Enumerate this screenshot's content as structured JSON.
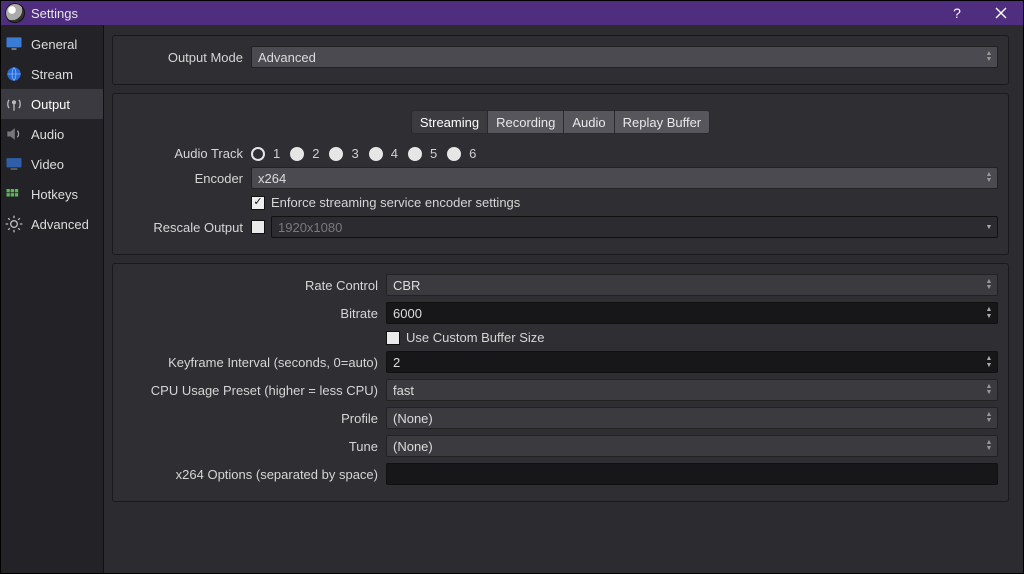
{
  "window": {
    "title": "Settings"
  },
  "titlebar": {
    "help": "?",
    "close": "✕"
  },
  "sidebar": {
    "items": [
      {
        "label": "General",
        "active": false
      },
      {
        "label": "Stream",
        "active": false
      },
      {
        "label": "Output",
        "active": true
      },
      {
        "label": "Audio",
        "active": false
      },
      {
        "label": "Video",
        "active": false
      },
      {
        "label": "Hotkeys",
        "active": false
      },
      {
        "label": "Advanced",
        "active": false
      }
    ]
  },
  "output": {
    "mode_label": "Output Mode",
    "mode_value": "Advanced",
    "tabs": [
      "Streaming",
      "Recording",
      "Audio",
      "Replay Buffer"
    ],
    "active_tab": "Streaming",
    "audio_track_label": "Audio Track",
    "audio_tracks": [
      "1",
      "2",
      "3",
      "4",
      "5",
      "6"
    ],
    "audio_track_selected": "1",
    "encoder_label": "Encoder",
    "encoder_value": "x264",
    "enforce_label": "Enforce streaming service encoder settings",
    "enforce_checked": true,
    "rescale_label": "Rescale Output",
    "rescale_checked": false,
    "rescale_value": "1920x1080",
    "rate_control_label": "Rate Control",
    "rate_control_value": "CBR",
    "bitrate_label": "Bitrate",
    "bitrate_value": "6000",
    "custom_buffer_label": "Use Custom Buffer Size",
    "custom_buffer_checked": false,
    "keyframe_label": "Keyframe Interval (seconds, 0=auto)",
    "keyframe_value": "2",
    "cpu_preset_label": "CPU Usage Preset (higher = less CPU)",
    "cpu_preset_value": "fast",
    "profile_label": "Profile",
    "profile_value": "(None)",
    "tune_label": "Tune",
    "tune_value": "(None)",
    "x264_opts_label": "x264 Options (separated by space)",
    "x264_opts_value": ""
  }
}
